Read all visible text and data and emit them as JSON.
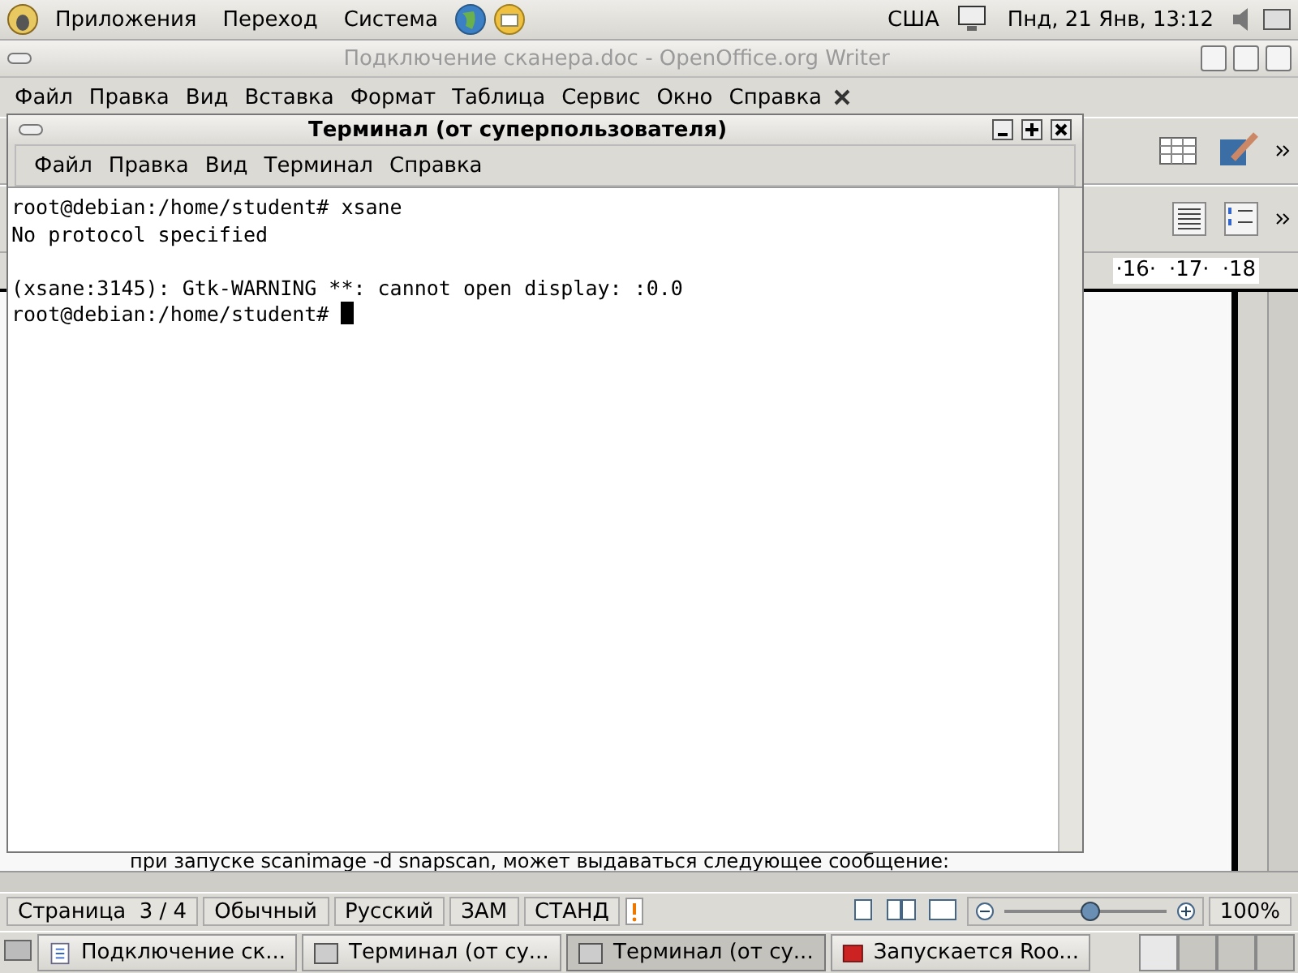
{
  "top_panel": {
    "menus": [
      "Приложения",
      "Переход",
      "Система"
    ],
    "keyboard_layout": "США",
    "clock": "Пнд, 21 Янв, 13:12"
  },
  "writer": {
    "title": "Подключение сканера.doc - OpenOffice.org Writer",
    "menu": [
      "Файл",
      "Правка",
      "Вид",
      "Вставка",
      "Формат",
      "Таблица",
      "Сервис",
      "Окно",
      "Справка"
    ],
    "ruler": [
      "·16·",
      "·17·",
      "·18"
    ],
    "document_line": "при запуске scanimage -d snapscan, может выдаваться следующее сообщение:",
    "status": {
      "page": "Страница  3 / 4",
      "style": "Обычный",
      "language": "Русский",
      "insert_mode": "ЗАМ",
      "selection_mode": "СТАНД",
      "zoom_slider": {
        "level": 0.53
      },
      "zoom": "100%"
    }
  },
  "terminal": {
    "title": "Терминал (от суперпользователя)",
    "menu": [
      "Файл",
      "Правка",
      "Вид",
      "Терминал",
      "Справка"
    ],
    "output_blocks": [
      [
        "root@debian:/home/student# xsane",
        "No protocol specified"
      ],
      [
        "(xsane:3145): Gtk-WARNING **: cannot open display: :0.0",
        "root@debian:/home/student#"
      ]
    ]
  },
  "taskbar": {
    "tasks": [
      {
        "label": "Подключение ск...",
        "kind": "document",
        "selected": false
      },
      {
        "label": "Терминал (от су...",
        "kind": "terminal",
        "selected": false
      },
      {
        "label": "Терминал (от су...",
        "kind": "terminal",
        "selected": true
      },
      {
        "label": "Запускается Roo...",
        "kind": "app",
        "selected": false
      }
    ],
    "workspaces": [
      {
        "selected": true
      },
      {
        "selected": false
      },
      {
        "selected": false
      },
      {
        "selected": false
      }
    ]
  }
}
